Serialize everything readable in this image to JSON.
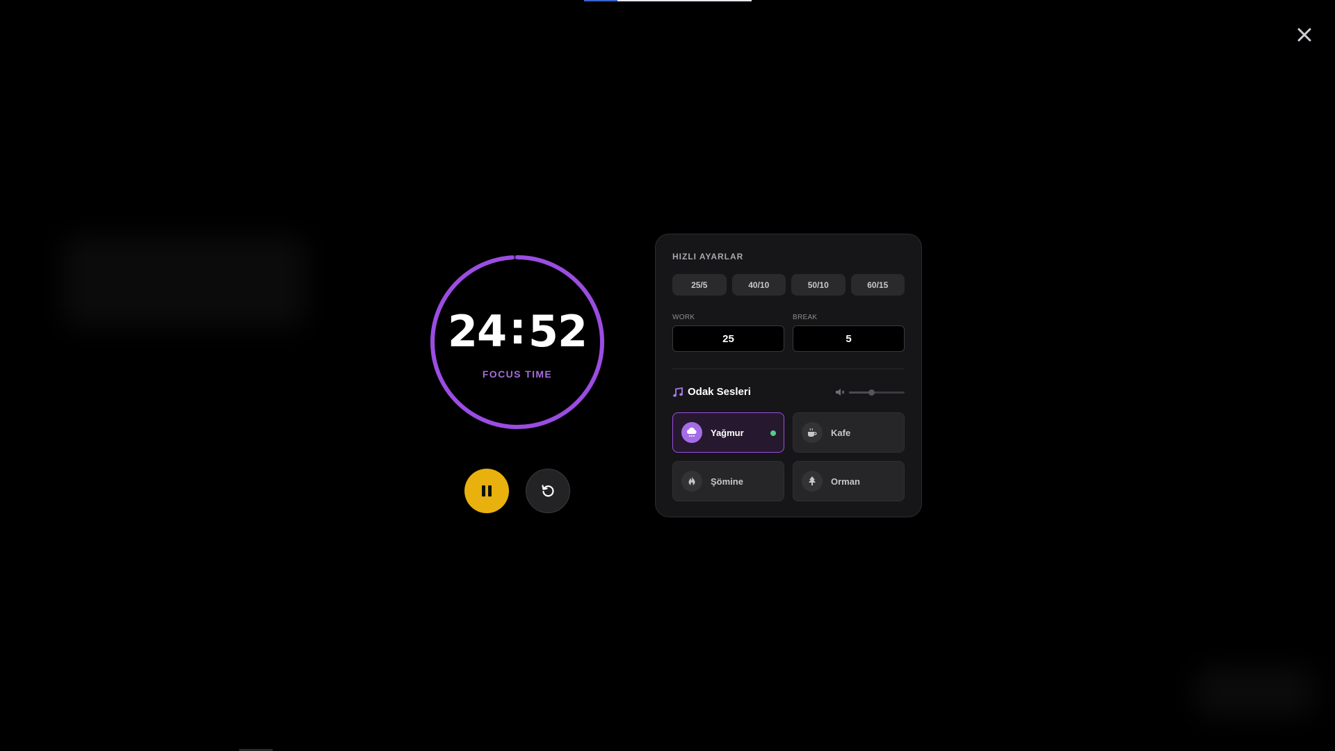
{
  "timer": {
    "minutes": "24",
    "separator": ":",
    "seconds": "52",
    "mode_label": "FOCUS TIME",
    "ring_progress": 0.99
  },
  "controls": {
    "pause_icon": "pause-icon",
    "reset_icon": "reset-icon",
    "close_icon": "close-icon"
  },
  "page_progress": 0.2,
  "panel": {
    "title": "HIZLI AYARLAR",
    "presets": [
      "25/5",
      "40/10",
      "50/10",
      "60/15"
    ],
    "work": {
      "label": "WORK",
      "value": "25"
    },
    "break": {
      "label": "BREAK",
      "value": "5"
    },
    "sounds": {
      "title": "Odak Sesleri",
      "volume": 0.4,
      "items": [
        {
          "name": "Yağmur",
          "icon": "rain-cloud-icon",
          "active": true
        },
        {
          "name": "Kafe",
          "icon": "coffee-cup-icon",
          "active": false
        },
        {
          "name": "Şömine",
          "icon": "fire-icon",
          "active": false
        },
        {
          "name": "Orman",
          "icon": "tree-icon",
          "active": false
        }
      ]
    }
  },
  "colors": {
    "accent": "#9b4de2",
    "pause": "#e8b10d",
    "active_dot": "#4fd08a"
  }
}
